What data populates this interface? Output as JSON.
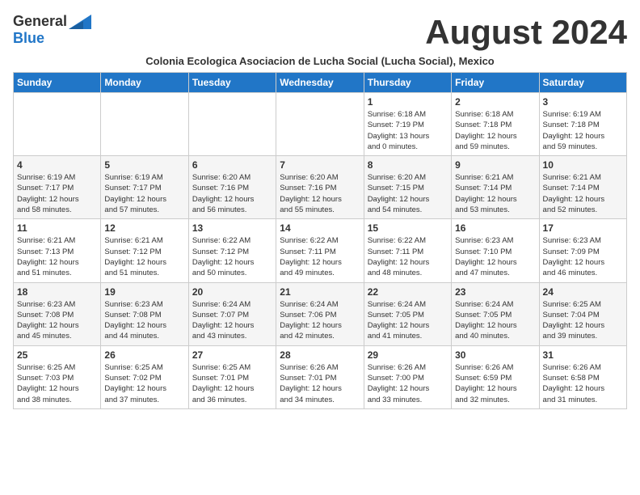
{
  "header": {
    "logo_general": "General",
    "logo_blue": "Blue",
    "month_year": "August 2024",
    "subtitle": "Colonia Ecologica Asociacion de Lucha Social (Lucha Social), Mexico"
  },
  "weekdays": [
    "Sunday",
    "Monday",
    "Tuesday",
    "Wednesday",
    "Thursday",
    "Friday",
    "Saturday"
  ],
  "weeks": [
    [
      {
        "day": "",
        "info": ""
      },
      {
        "day": "",
        "info": ""
      },
      {
        "day": "",
        "info": ""
      },
      {
        "day": "",
        "info": ""
      },
      {
        "day": "1",
        "info": "Sunrise: 6:18 AM\nSunset: 7:19 PM\nDaylight: 13 hours\nand 0 minutes."
      },
      {
        "day": "2",
        "info": "Sunrise: 6:18 AM\nSunset: 7:18 PM\nDaylight: 12 hours\nand 59 minutes."
      },
      {
        "day": "3",
        "info": "Sunrise: 6:19 AM\nSunset: 7:18 PM\nDaylight: 12 hours\nand 59 minutes."
      }
    ],
    [
      {
        "day": "4",
        "info": "Sunrise: 6:19 AM\nSunset: 7:17 PM\nDaylight: 12 hours\nand 58 minutes."
      },
      {
        "day": "5",
        "info": "Sunrise: 6:19 AM\nSunset: 7:17 PM\nDaylight: 12 hours\nand 57 minutes."
      },
      {
        "day": "6",
        "info": "Sunrise: 6:20 AM\nSunset: 7:16 PM\nDaylight: 12 hours\nand 56 minutes."
      },
      {
        "day": "7",
        "info": "Sunrise: 6:20 AM\nSunset: 7:16 PM\nDaylight: 12 hours\nand 55 minutes."
      },
      {
        "day": "8",
        "info": "Sunrise: 6:20 AM\nSunset: 7:15 PM\nDaylight: 12 hours\nand 54 minutes."
      },
      {
        "day": "9",
        "info": "Sunrise: 6:21 AM\nSunset: 7:14 PM\nDaylight: 12 hours\nand 53 minutes."
      },
      {
        "day": "10",
        "info": "Sunrise: 6:21 AM\nSunset: 7:14 PM\nDaylight: 12 hours\nand 52 minutes."
      }
    ],
    [
      {
        "day": "11",
        "info": "Sunrise: 6:21 AM\nSunset: 7:13 PM\nDaylight: 12 hours\nand 51 minutes."
      },
      {
        "day": "12",
        "info": "Sunrise: 6:21 AM\nSunset: 7:12 PM\nDaylight: 12 hours\nand 51 minutes."
      },
      {
        "day": "13",
        "info": "Sunrise: 6:22 AM\nSunset: 7:12 PM\nDaylight: 12 hours\nand 50 minutes."
      },
      {
        "day": "14",
        "info": "Sunrise: 6:22 AM\nSunset: 7:11 PM\nDaylight: 12 hours\nand 49 minutes."
      },
      {
        "day": "15",
        "info": "Sunrise: 6:22 AM\nSunset: 7:11 PM\nDaylight: 12 hours\nand 48 minutes."
      },
      {
        "day": "16",
        "info": "Sunrise: 6:23 AM\nSunset: 7:10 PM\nDaylight: 12 hours\nand 47 minutes."
      },
      {
        "day": "17",
        "info": "Sunrise: 6:23 AM\nSunset: 7:09 PM\nDaylight: 12 hours\nand 46 minutes."
      }
    ],
    [
      {
        "day": "18",
        "info": "Sunrise: 6:23 AM\nSunset: 7:08 PM\nDaylight: 12 hours\nand 45 minutes."
      },
      {
        "day": "19",
        "info": "Sunrise: 6:23 AM\nSunset: 7:08 PM\nDaylight: 12 hours\nand 44 minutes."
      },
      {
        "day": "20",
        "info": "Sunrise: 6:24 AM\nSunset: 7:07 PM\nDaylight: 12 hours\nand 43 minutes."
      },
      {
        "day": "21",
        "info": "Sunrise: 6:24 AM\nSunset: 7:06 PM\nDaylight: 12 hours\nand 42 minutes."
      },
      {
        "day": "22",
        "info": "Sunrise: 6:24 AM\nSunset: 7:05 PM\nDaylight: 12 hours\nand 41 minutes."
      },
      {
        "day": "23",
        "info": "Sunrise: 6:24 AM\nSunset: 7:05 PM\nDaylight: 12 hours\nand 40 minutes."
      },
      {
        "day": "24",
        "info": "Sunrise: 6:25 AM\nSunset: 7:04 PM\nDaylight: 12 hours\nand 39 minutes."
      }
    ],
    [
      {
        "day": "25",
        "info": "Sunrise: 6:25 AM\nSunset: 7:03 PM\nDaylight: 12 hours\nand 38 minutes."
      },
      {
        "day": "26",
        "info": "Sunrise: 6:25 AM\nSunset: 7:02 PM\nDaylight: 12 hours\nand 37 minutes."
      },
      {
        "day": "27",
        "info": "Sunrise: 6:25 AM\nSunset: 7:01 PM\nDaylight: 12 hours\nand 36 minutes."
      },
      {
        "day": "28",
        "info": "Sunrise: 6:26 AM\nSunset: 7:01 PM\nDaylight: 12 hours\nand 34 minutes."
      },
      {
        "day": "29",
        "info": "Sunrise: 6:26 AM\nSunset: 7:00 PM\nDaylight: 12 hours\nand 33 minutes."
      },
      {
        "day": "30",
        "info": "Sunrise: 6:26 AM\nSunset: 6:59 PM\nDaylight: 12 hours\nand 32 minutes."
      },
      {
        "day": "31",
        "info": "Sunrise: 6:26 AM\nSunset: 6:58 PM\nDaylight: 12 hours\nand 31 minutes."
      }
    ]
  ]
}
